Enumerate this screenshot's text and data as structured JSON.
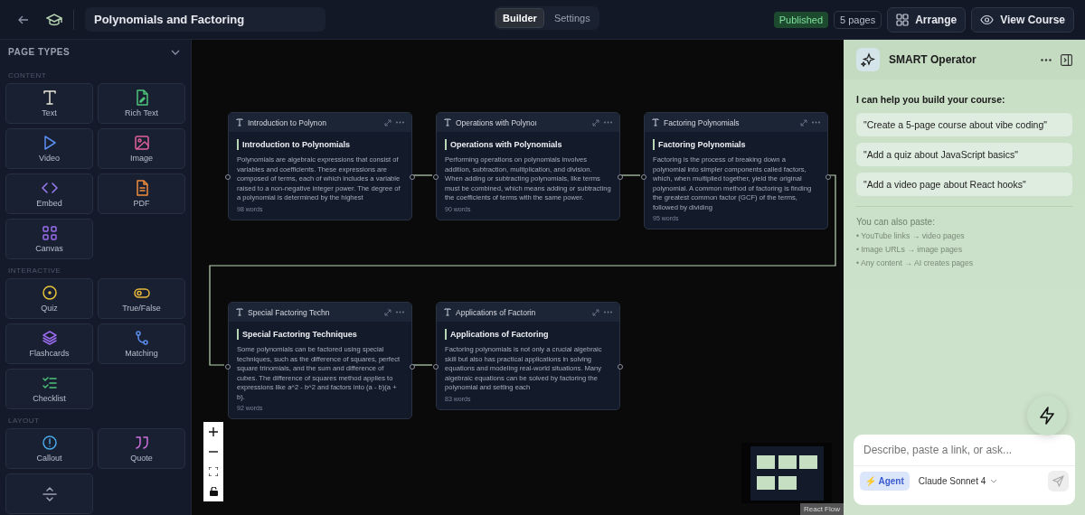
{
  "topbar": {
    "course_title": "Polynomials and Factoring",
    "tabs": [
      {
        "label": "Builder",
        "selected": true
      },
      {
        "label": "Settings",
        "selected": false
      }
    ],
    "status": "Published",
    "page_count": "5 pages",
    "buttons": [
      {
        "kind": "arrange",
        "label": "Arrange"
      },
      {
        "kind": "view",
        "label": "View Course"
      }
    ]
  },
  "sidebar": {
    "title": "PAGE TYPES",
    "expanded": true,
    "sections": [
      {
        "label": "CONTENT",
        "items": [
          {
            "kind": "text",
            "label": "Text"
          },
          {
            "kind": "richtext",
            "label": "Rich Text"
          },
          {
            "kind": "video",
            "label": "Video"
          },
          {
            "kind": "image",
            "label": "Image"
          },
          {
            "kind": "embed",
            "label": "Embed"
          },
          {
            "kind": "pdf",
            "label": "PDF"
          },
          {
            "kind": "canvas",
            "label": "Canvas"
          }
        ]
      },
      {
        "label": "INTERACTIVE",
        "items": [
          {
            "kind": "quiz",
            "label": "Quiz"
          },
          {
            "kind": "truefalse",
            "label": "True/False"
          },
          {
            "kind": "flashcards",
            "label": "Flashcards"
          },
          {
            "kind": "matching",
            "label": "Matching"
          },
          {
            "kind": "checklist",
            "label": "Checklist"
          }
        ]
      },
      {
        "label": "LAYOUT",
        "items": [
          {
            "kind": "callout",
            "label": "Callout"
          },
          {
            "kind": "quote",
            "label": "Quote"
          },
          {
            "kind": "divider"
          }
        ]
      }
    ]
  },
  "canvas": {
    "nodes": [
      {
        "tab_title": "Introduction to Polynon",
        "heading": "Introduction to Polynomials",
        "body": "Polynomials are algebraic expressions that consist of variables and coefficients. These expressions are composed of terms, each of which includes a variable raised to a non-negative integer power. The degree of a polynomial is determined by the highest",
        "words": "98 words"
      },
      {
        "tab_title": "Operations with Polynoı",
        "heading": "Operations with Polynomials",
        "body": "Performing operations on polynomials involves addition, subtraction, multiplication, and division. When adding or subtracting polynomials, like terms must be combined, which means adding or subtracting the coefficients of terms with the same power.",
        "words": "90 words"
      },
      {
        "tab_title": "Factoring Polynomials",
        "heading": "Factoring Polynomials",
        "body": "Factoring is the process of breaking down a polynomial into simpler components called factors, which, when multiplied together, yield the original polynomial. A common method of factoring is finding the greatest common factor (GCF) of the terms, followed by dividing",
        "words": "95 words"
      },
      {
        "tab_title": "Special Factoring Techn",
        "heading": "Special Factoring Techniques",
        "body": "Some polynomials can be factored using special techniques, such as the difference of squares, perfect square trinomials, and the sum and difference of cubes. The difference of squares method applies to expressions like a^2 - b^2 and factors into (a - b)(a + b).",
        "words": "92 words"
      },
      {
        "tab_title": "Applications of Factorin",
        "heading": "Applications of Factoring",
        "body": "Factoring polynomials is not only a crucial algebraic skill but also has practical applications in solving equations and modeling real-world situations. Many algebraic equations can be solved by factoring the polynomial and setting each",
        "words": "83 words"
      }
    ],
    "attribution": "React Flow"
  },
  "assistant": {
    "title": "SMART Operator",
    "intro": "I can help you build your course:",
    "suggestions": [
      "\"Create a 5-page course about vibe coding\"",
      "\"Add a quiz about JavaScript basics\"",
      "\"Add a video page about React hooks\""
    ],
    "paste_title": "You can also paste:",
    "paste_items": [
      "• YouTube links → video pages",
      "• Image URLs → image pages",
      "• Any content → AI creates pages"
    ],
    "input": {
      "placeholder": "Describe, paste a link, or ask..."
    },
    "mode": "⚡ Agent",
    "model": "Claude Sonnet 4"
  }
}
